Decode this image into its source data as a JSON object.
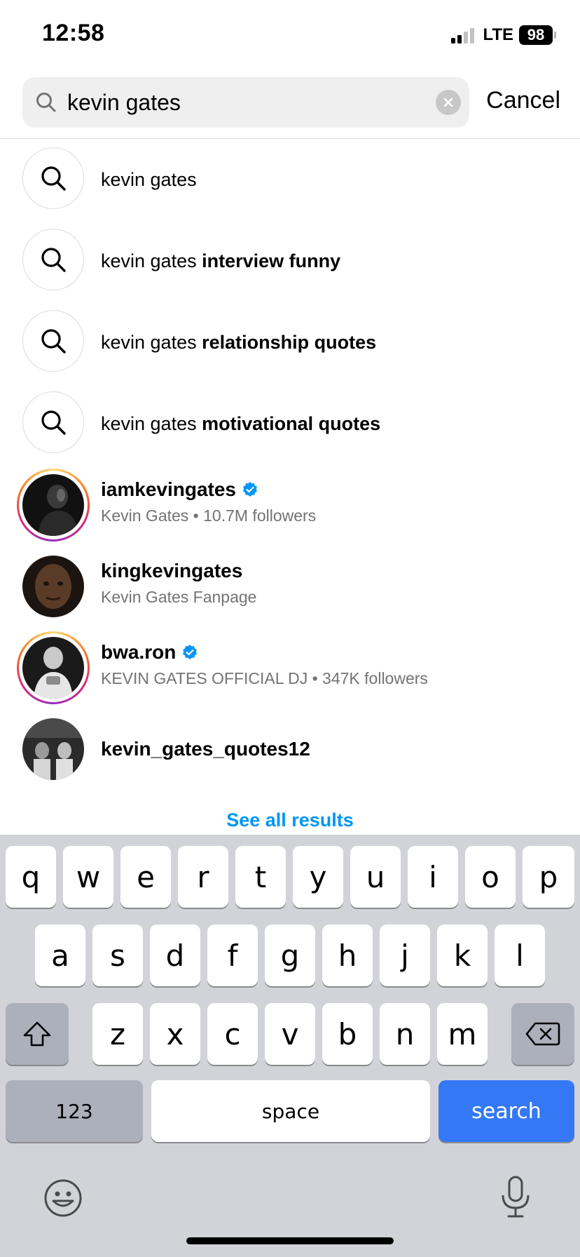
{
  "status_bar": {
    "time": "12:58",
    "network": "LTE",
    "battery": "98"
  },
  "search": {
    "query": "kevin gates",
    "cancel_label": "Cancel"
  },
  "suggestions": [
    {
      "prefix": "kevin gates",
      "suffix": ""
    },
    {
      "prefix": "kevin gates ",
      "suffix": "interview funny"
    },
    {
      "prefix": "kevin gates ",
      "suffix": "relationship quotes"
    },
    {
      "prefix": "kevin gates ",
      "suffix": "motivational quotes"
    }
  ],
  "accounts": [
    {
      "username": "iamkevingates",
      "verified": true,
      "subtitle": "Kevin Gates • 10.7M followers",
      "story_ring": true
    },
    {
      "username": "kingkevingates",
      "verified": false,
      "subtitle": "Kevin Gates Fanpage",
      "story_ring": false
    },
    {
      "username": "bwa.ron",
      "verified": true,
      "subtitle": "KEVIN GATES OFFICIAL DJ • 347K followers",
      "story_ring": true
    },
    {
      "username": "kevin_gates_quotes12",
      "verified": false,
      "subtitle": "",
      "story_ring": false
    }
  ],
  "see_all_label": "See all results",
  "keyboard": {
    "row1": [
      "q",
      "w",
      "e",
      "r",
      "t",
      "y",
      "u",
      "i",
      "o",
      "p"
    ],
    "row2": [
      "a",
      "s",
      "d",
      "f",
      "g",
      "h",
      "j",
      "k",
      "l"
    ],
    "row3": [
      "z",
      "x",
      "c",
      "v",
      "b",
      "n",
      "m"
    ],
    "numbers_label": "123",
    "space_label": "space",
    "action_label": "search"
  },
  "colors": {
    "accent": "#0095f6",
    "verified": "#0095f6",
    "keyboard_action": "#3478f6",
    "keyboard_bg": "#d1d3d9"
  }
}
